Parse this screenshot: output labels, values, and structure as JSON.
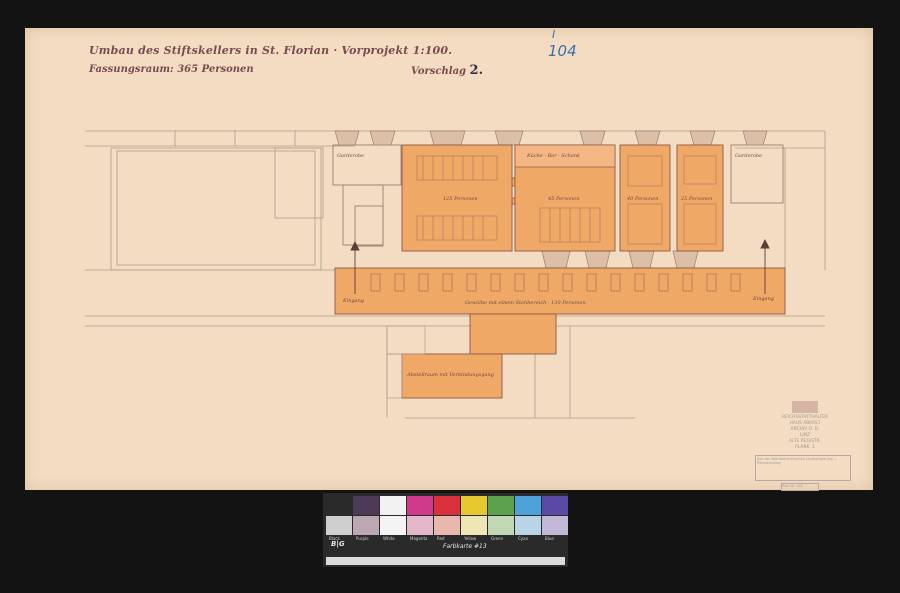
{
  "sheet": {
    "title_line1": "Umbau des Stiftskellers in St. Florian · Vorprojekt 1:100.",
    "title_line2_prefix": "Vorschlag",
    "variant_number": "2.",
    "title_line2": "Fassungsraum: 365 Personen",
    "sheet_mark_roman": "I",
    "sheet_number": "104"
  },
  "plan_labels": {
    "room_left_top": "Garderobe",
    "room_right_top": "Garderobe",
    "room_a": "125 Personen",
    "room_b": "45 Personen",
    "room_c": "40 Personen",
    "room_d": "25 Personen",
    "kitchen": "Küche · Bar · Schank",
    "corridor": "Gewölbe mit einem Stehbereich · 130 Personen",
    "entrance_left": "Eingang",
    "entrance_right": "Eingang",
    "annex": "Abstellraum mit Verbindungsgang"
  },
  "stamps": {
    "office": [
      "REICHSSTATTHALTER",
      "HAUS ABHOLT",
      "ARCHIV O. D.",
      "LINZ",
      "ALTE REGISTR.",
      "PLANK. 1"
    ],
    "box": "Amt der Oberösterreichischen Landesregierung — Plansammlung",
    "small": "Plan Nr. 104"
  },
  "color_target": {
    "logo": "B|G",
    "name": "Farbkarte #13",
    "top_row_colors": [
      "#2a2a2a",
      "#4d3a55",
      "#f2f2f2",
      "#cf3b8a",
      "#d8303c",
      "#e6c92c",
      "#5aa04d",
      "#4fa2d9",
      "#5b4aa3"
    ],
    "bottom_row_colors": [
      "#cfcfcf",
      "#bda7b4",
      "#f4f4f4",
      "#e4b7cb",
      "#e8b7ae",
      "#efe6b7",
      "#c1d8b4",
      "#b9d4e6",
      "#c2b7d6"
    ],
    "labels": [
      "Black",
      "Purple",
      "White",
      "Magenta",
      "Red",
      "Yellow",
      "Green",
      "Cyan",
      "Blue"
    ]
  },
  "colors": {
    "paper": "#f3dcc1",
    "wash": "#f0a867",
    "ink": "#7a4a52"
  }
}
